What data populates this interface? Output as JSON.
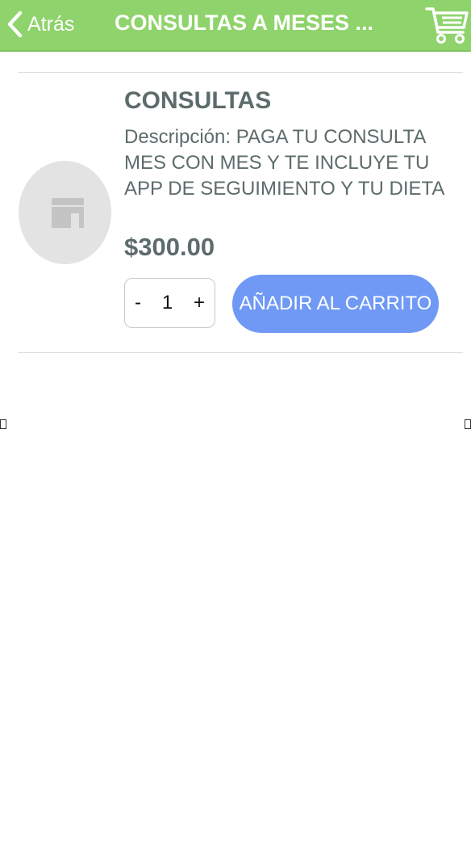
{
  "navbar": {
    "back_label": "Atrás",
    "title": "CONSULTAS A MESES ...",
    "background_color": "#8ed36b",
    "icons": {
      "back": "chevron-left-icon",
      "cart": "shopping-cart-icon"
    }
  },
  "product": {
    "image_icon": "store-icon",
    "name": "CONSULTAS",
    "description": "Descripción: PAGA TU CONSULTA MES CON MES Y TE INCLUYE TU APP DE SEGUIMIENTO Y TU DIETA",
    "price": "$300.00",
    "quantity": {
      "minus_label": "-",
      "value": "1",
      "plus_label": "+"
    },
    "add_to_cart_label": "AÑADIR AL CARRITO",
    "add_to_cart_color": "#6f99f4"
  }
}
